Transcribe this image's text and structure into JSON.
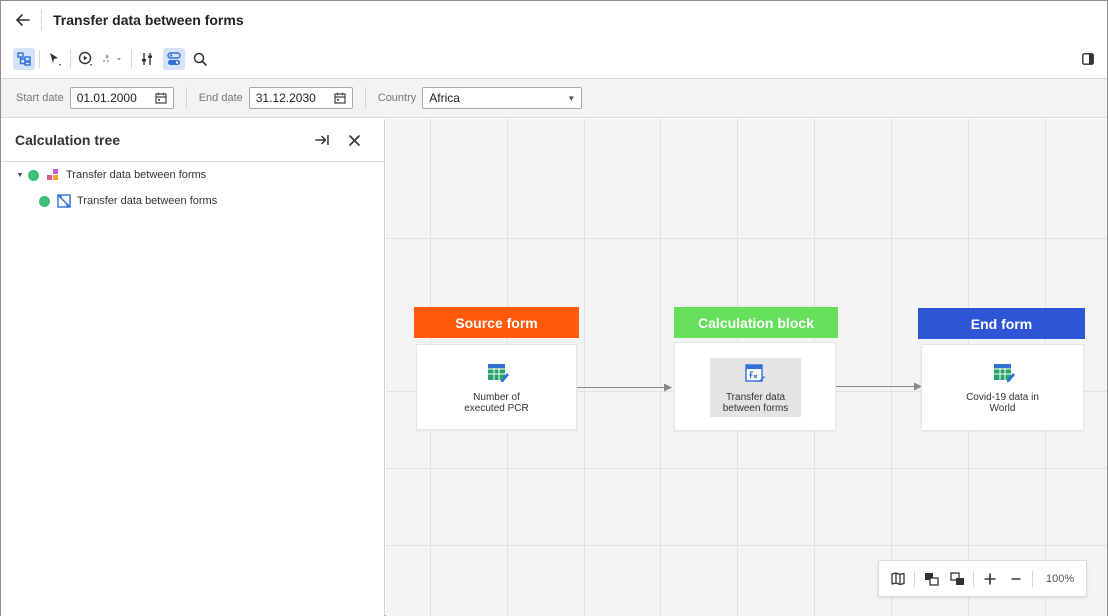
{
  "header": {
    "title": "Transfer data between forms"
  },
  "toolbar": {
    "icons": [
      "structure-icon",
      "select-pointer-icon",
      "run-icon",
      "step-run-icon",
      "dropdown-caret-icon",
      "settings-sliders-icon",
      "toggle-view-icon",
      "search-icon",
      "panel-toggle-icon"
    ]
  },
  "params": {
    "start_label": "Start date",
    "start_value": "01.01.2000",
    "end_label": "End date",
    "end_value": "31.12.2030",
    "country_label": "Country",
    "country_value": "Africa"
  },
  "tree_panel": {
    "title": "Calculation tree",
    "items": [
      {
        "label": "Transfer data between forms",
        "status_color": "#3bbf78"
      },
      {
        "label": "Transfer data between forms",
        "status_color": "#3bbf78"
      }
    ]
  },
  "canvas": {
    "nodes": [
      {
        "header": "Source form",
        "header_color": "#ff5a0a",
        "label_line1": "Number of",
        "label_line2": "executed PCR"
      },
      {
        "header": "Calculation block",
        "header_color": "#66e05a",
        "label_line1": "Transfer data",
        "label_line2": "between forms"
      },
      {
        "header": "End form",
        "header_color": "#2d55d6",
        "label_line1": "Covid-19 data in",
        "label_line2": "World"
      }
    ]
  },
  "zoom": {
    "value": "100%"
  },
  "colors": {
    "accent": "#2f6fd6",
    "active_tool_bg": "#d4e3f7",
    "status_green": "#3bbf78"
  }
}
